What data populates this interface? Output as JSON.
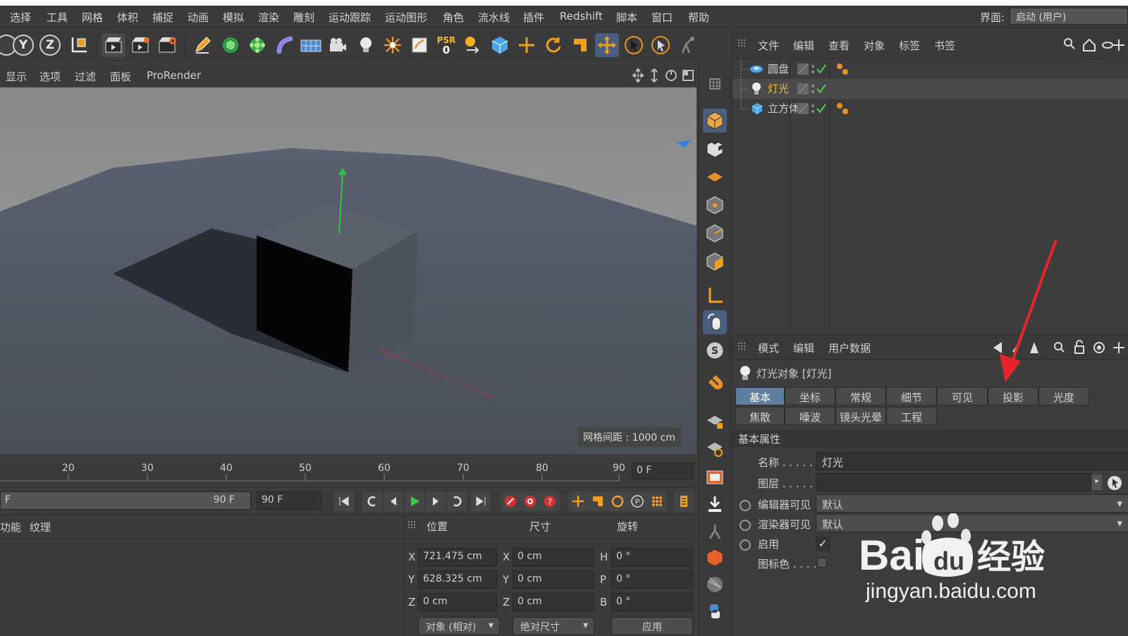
{
  "app": {
    "layout_label": "界面:",
    "layout_value": "启动 (用户)"
  },
  "menu": [
    "选择",
    "工具",
    "网格",
    "体积",
    "捕捉",
    "动画",
    "模拟",
    "渲染",
    "雕刻",
    "运动跟踪",
    "运动图形",
    "角色",
    "流水线",
    "插件",
    "Redshift",
    "脚本",
    "窗口",
    "帮助"
  ],
  "toolbar": {
    "axis_y": "Y",
    "axis_z": "Z",
    "psr": "PSR",
    "psr_value": "0"
  },
  "viewport_menu": [
    "显示",
    "选项",
    "过滤",
    "面板",
    "ProRender"
  ],
  "viewport": {
    "grid_spacing": "网格间距 : 1000 cm"
  },
  "timeline": {
    "ticks": [
      "20",
      "30",
      "40",
      "50",
      "60",
      "70",
      "80",
      "90"
    ],
    "current_frame": "0 F"
  },
  "transport": {
    "start_field": "F",
    "range_end": "90 F",
    "end_field": "90 F"
  },
  "bottom_left": {
    "tabs": [
      "功能",
      "纹理"
    ]
  },
  "coordinates": {
    "headers": {
      "position": "位置",
      "size": "尺寸",
      "rotation": "旋转"
    },
    "axes": [
      "X",
      "Y",
      "Z"
    ],
    "rot_axes": [
      "H",
      "P",
      "B"
    ],
    "position": [
      "721.475 cm",
      "628.325 cm",
      "0 cm"
    ],
    "size": [
      "0 cm",
      "0 cm",
      "0 cm"
    ],
    "rotation": [
      "0 °",
      "0 °",
      "0 °"
    ],
    "mode_select": "对象 (相对)",
    "size_select": "绝对尺寸",
    "apply": "应用"
  },
  "object_manager": {
    "menu": [
      "文件",
      "编辑",
      "查看",
      "对象",
      "标签",
      "书签"
    ],
    "objects": [
      {
        "name": "圆盘",
        "selected": false,
        "color": "#d0d0d0"
      },
      {
        "name": "灯光",
        "selected": true,
        "color": "#f0c030"
      },
      {
        "name": "立方体",
        "selected": false,
        "color": "#d0d0d0"
      }
    ]
  },
  "attributes": {
    "menu": [
      "模式",
      "编辑",
      "用户数据"
    ],
    "object_title": "灯光对象 [灯光]",
    "tabs_row1": [
      "基本",
      "坐标",
      "常规",
      "细节",
      "可见",
      "投影",
      "光度"
    ],
    "tabs_row2": [
      "焦散",
      "噪波",
      "镜头光晕",
      "工程"
    ],
    "active_tab": "基本",
    "section": "基本属性",
    "name_label": "名称 . . . . . .",
    "name_value": "灯光",
    "layer_label": "图层 . . . . . .",
    "layer_value": "",
    "editor_visible_label": "编辑器可见",
    "editor_visible_value": "默认",
    "render_visible_label": "渲染器可见",
    "render_visible_value": "默认",
    "enabled_label": "启用",
    "enabled_check": "✓",
    "icon_color_label": "图标色 . . . .",
    "annotation_color": "#e8242a"
  },
  "watermark": {
    "logo_a": "Bai",
    "logo_b": "du",
    "logo_c": "经验",
    "url": "jingyan.baidu.com"
  }
}
